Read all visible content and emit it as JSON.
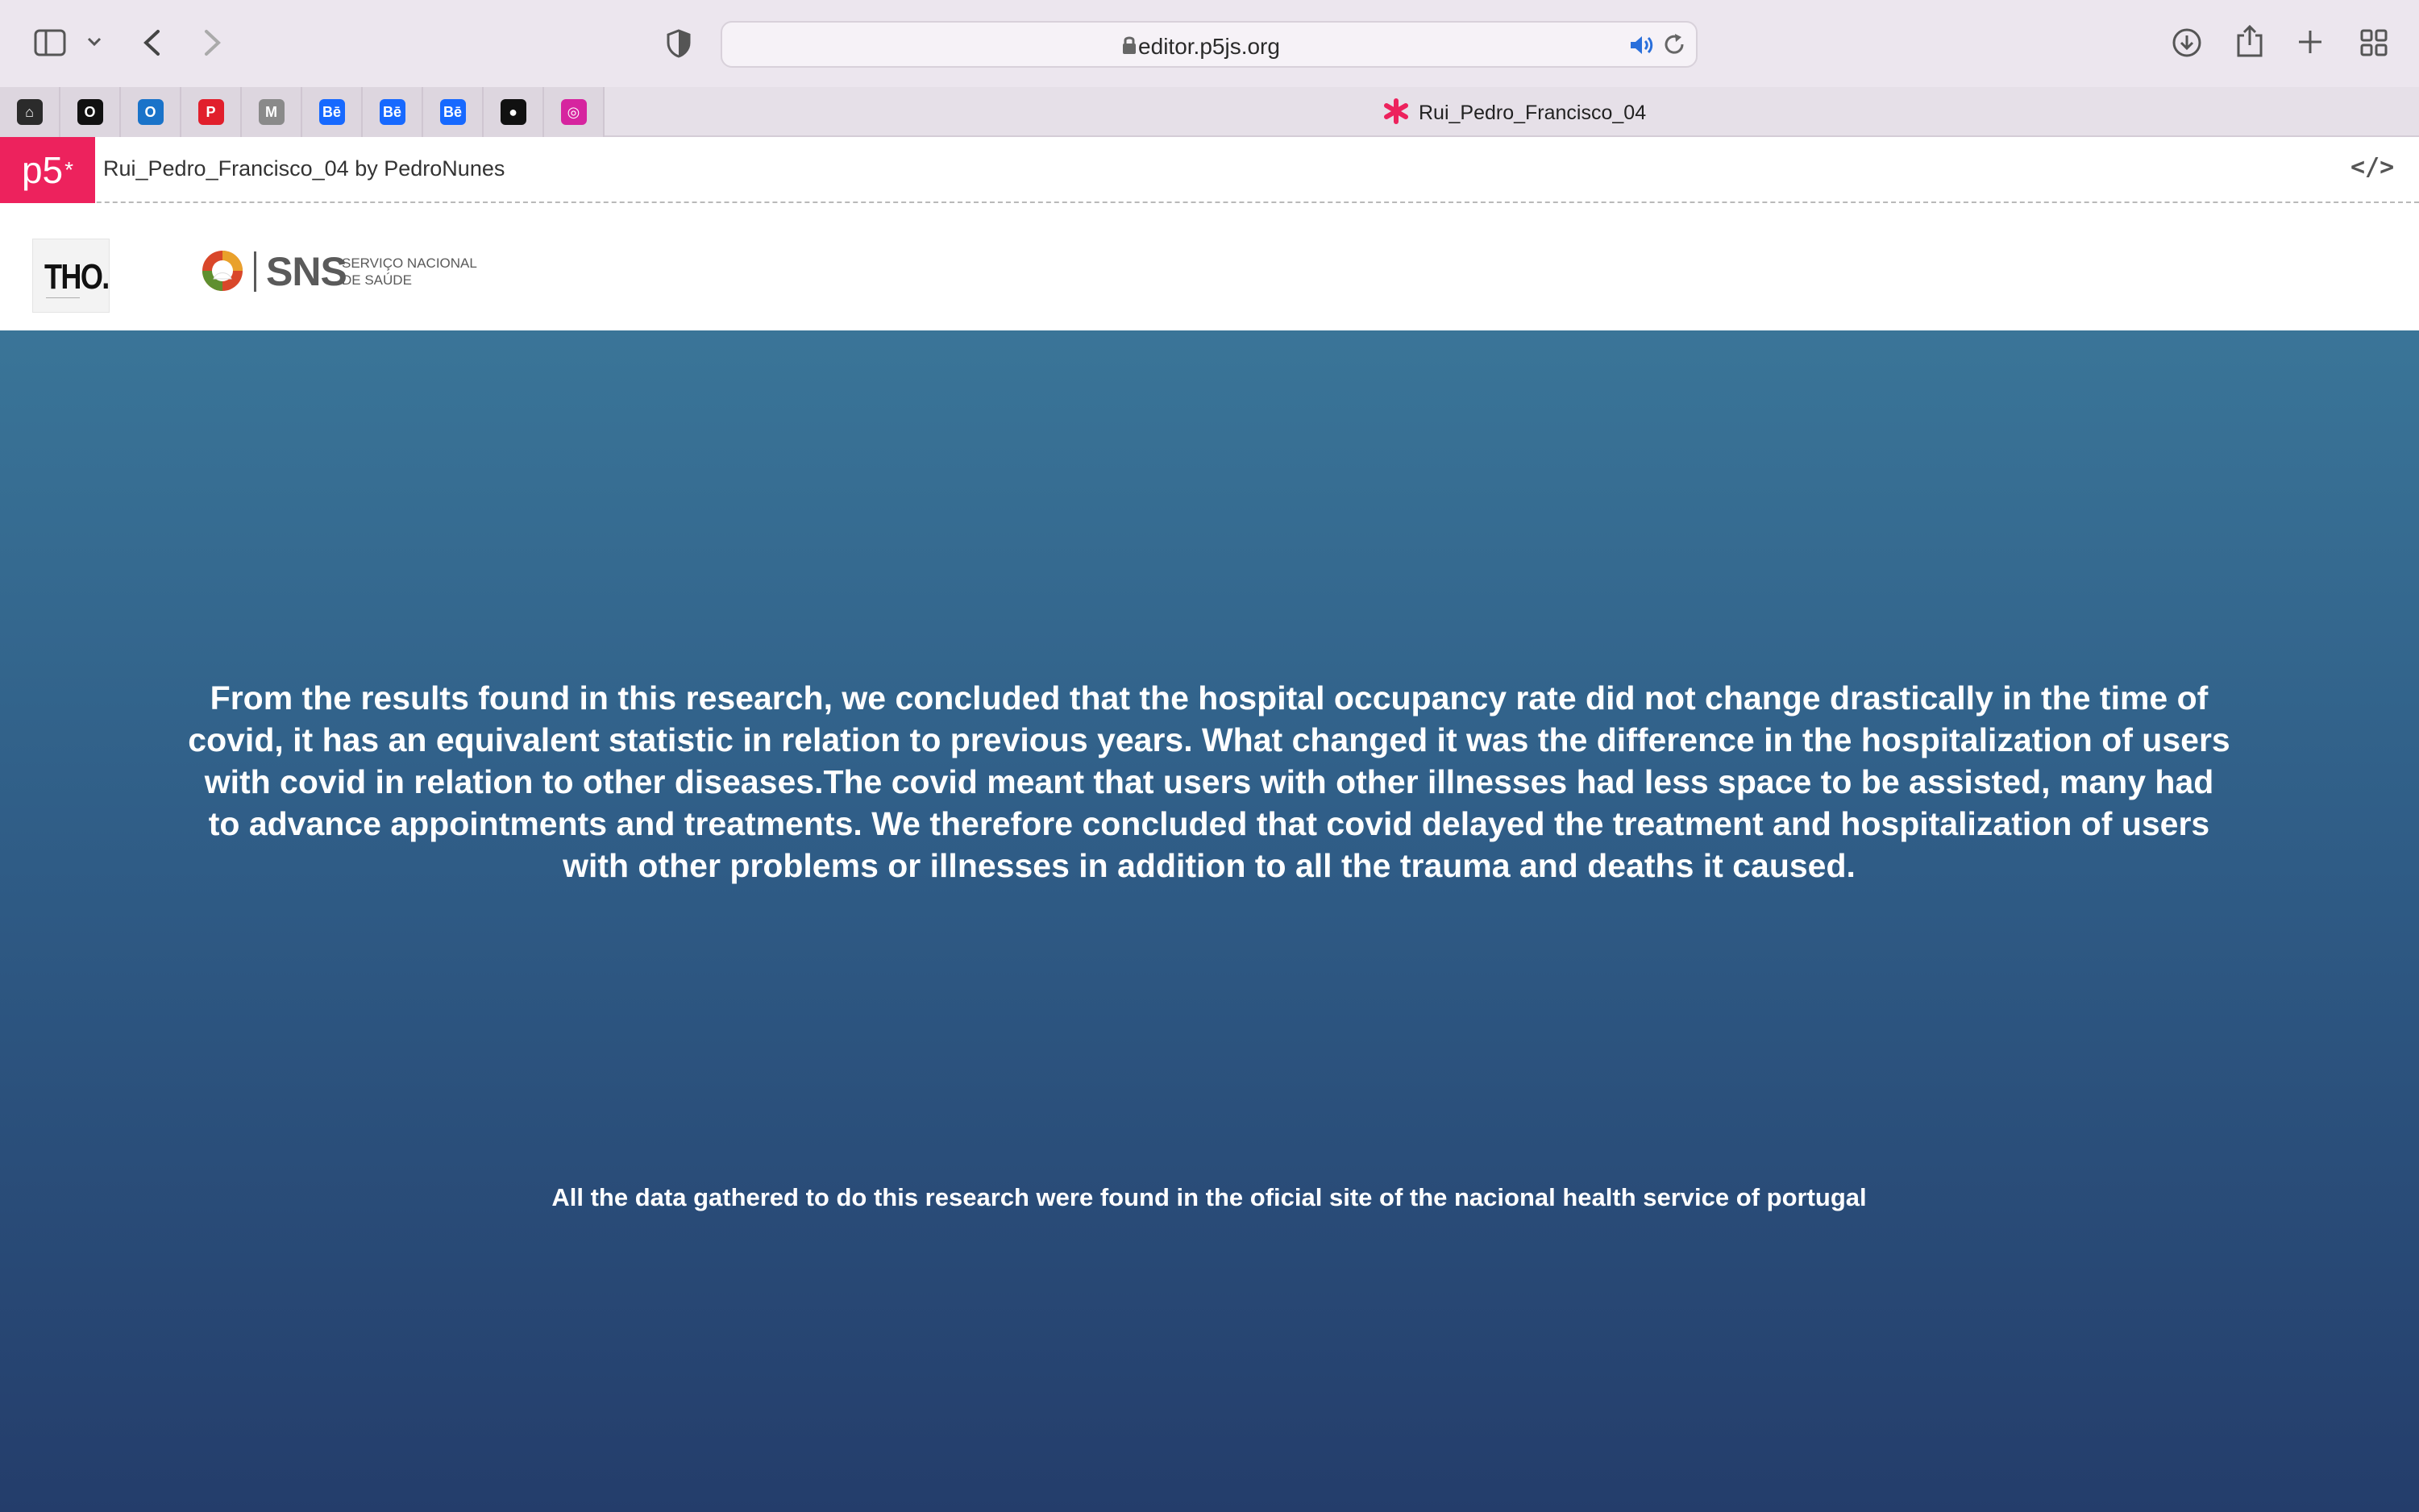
{
  "browser": {
    "url": "editor.p5js.org",
    "icons": [
      "sidebar-icon",
      "chevron-down-icon",
      "back-icon",
      "forward-icon",
      "shield-icon",
      "lock-icon",
      "speaker-icon",
      "reload-icon",
      "download-icon",
      "share-icon",
      "plus-icon",
      "tab-grid-icon"
    ]
  },
  "favorites": [
    {
      "name": "home-icon",
      "color": "#2b2b2b",
      "glyph": "⌂"
    },
    {
      "name": "circle-app-icon",
      "color": "#111111",
      "glyph": "O"
    },
    {
      "name": "outlook-icon",
      "color": "#1a73c9",
      "glyph": "O"
    },
    {
      "name": "pinterest-icon",
      "color": "#e11f2c",
      "glyph": "P"
    },
    {
      "name": "medium-icon",
      "color": "#8a8a8a",
      "glyph": "M"
    },
    {
      "name": "behance-icon",
      "color": "#1769ff",
      "glyph": "Bē"
    },
    {
      "name": "behance-icon",
      "color": "#1769ff",
      "glyph": "Bē"
    },
    {
      "name": "behance-icon",
      "color": "#1769ff",
      "glyph": "Bē"
    },
    {
      "name": "github-icon",
      "color": "#111111",
      "glyph": "●"
    },
    {
      "name": "instagram-icon",
      "color": "#d6249f",
      "glyph": "◎"
    }
  ],
  "tab": {
    "title": "Rui_Pedro_Francisco_04"
  },
  "editor": {
    "logo": "p5",
    "logo_mark": "*",
    "sketch_name": "Rui_Pedro_Francisco_04",
    "by_label": "by",
    "author": "PedroNunes",
    "code_toggle": "</>"
  },
  "canvas": {
    "tho_logo": "THO.",
    "sns_logo": "SNS",
    "sns_subtitle_1": "SERVIÇO NACIONAL",
    "sns_subtitle_2": "DE SAÚDE",
    "conclusion": "From the results found in this research, we concluded that the hospital occupancy rate did not change drastically in the time of covid, it has an equivalent statistic in relation to previous years. What changed it was the difference in the hospitalization of users with covid in relation to other diseases.The covid meant that users with other illnesses had less space to be assisted, many had to advance appointments and treatments. We therefore concluded that covid delayed the treatment and hospitalization of users with other problems or illnesses in addition to all the trauma and deaths it caused.",
    "source_note": "All the data gathered to do this research were found in the oficial site of the nacional health service of portugal"
  },
  "colors": {
    "p5_brand": "#ed225d",
    "gradient_top": "#3a7598",
    "gradient_bottom": "#243d6b"
  }
}
